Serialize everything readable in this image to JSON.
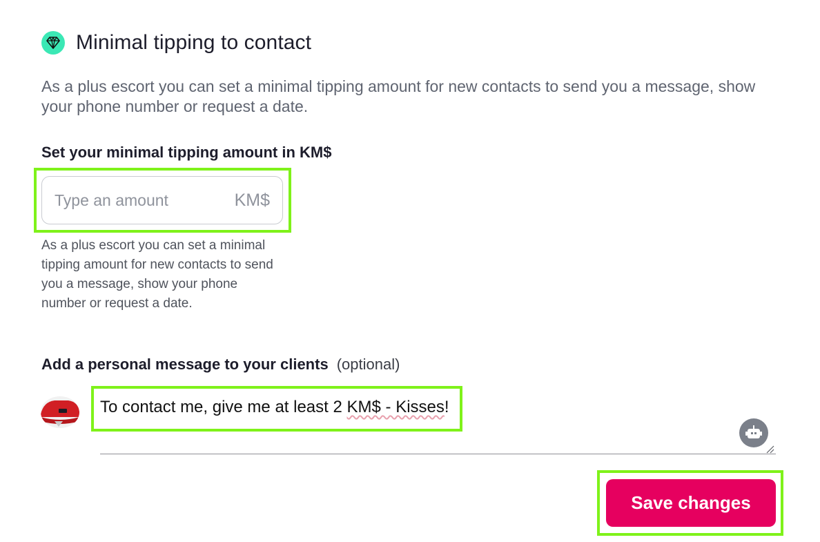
{
  "header": {
    "icon": "diamond-icon",
    "title": "Minimal tipping to contact"
  },
  "intro": "As a plus escort you can set a minimal tipping amount for new contacts to send you a message, show your phone number or request a date.",
  "amount": {
    "label": "Set your minimal tipping amount in KM$",
    "placeholder": "Type an amount",
    "value": "",
    "suffix": "KM$",
    "helper": "As a plus escort you can set a minimal tipping amount for new contacts to send you a message, show your phone number or request a date."
  },
  "message": {
    "label": "Add a personal message to your clients",
    "optional": "(optional)",
    "text_before": "To contact me, give me at least 2 ",
    "text_flagged": "KM$ - Kisses",
    "text_after": "!"
  },
  "actions": {
    "save_label": "Save changes"
  },
  "colors": {
    "accent": "#e6005f",
    "badge": "#3be8b5",
    "highlight": "#7ff21a"
  }
}
